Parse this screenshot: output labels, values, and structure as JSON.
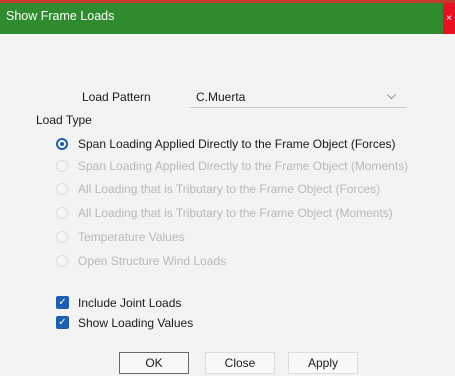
{
  "window": {
    "title": "Show Frame Loads",
    "close_glyph": "×"
  },
  "load_pattern": {
    "label": "Load Pattern",
    "value": "C.Muerta",
    "chevron": "⌵"
  },
  "load_type": {
    "title": "Load Type",
    "options": [
      {
        "label": "Span Loading Applied Directly to the Frame Object (Forces)",
        "checked": true,
        "enabled": true
      },
      {
        "label": "Span Loading Applied Directly to the Frame Object (Moments)",
        "checked": false,
        "enabled": false
      },
      {
        "label": "All Loading that is Tributary to the Frame Object (Forces)",
        "checked": false,
        "enabled": false
      },
      {
        "label": "All Loading that is Tributary to the Frame Object (Moments)",
        "checked": false,
        "enabled": false
      },
      {
        "label": "Temperature Values",
        "checked": false,
        "enabled": false
      },
      {
        "label": "Open Structure Wind Loads",
        "checked": false,
        "enabled": false
      }
    ]
  },
  "checkboxes": [
    {
      "label": "Include Joint Loads",
      "checked": true,
      "glyph": "✓"
    },
    {
      "label": "Show Loading Values",
      "checked": true,
      "glyph": "✓"
    }
  ],
  "buttons": {
    "ok": "OK",
    "close": "Close",
    "apply": "Apply"
  },
  "colors": {
    "titlebar": "#2e8b2e",
    "accent": "#1a5fb4",
    "close_button": "#e81123"
  }
}
